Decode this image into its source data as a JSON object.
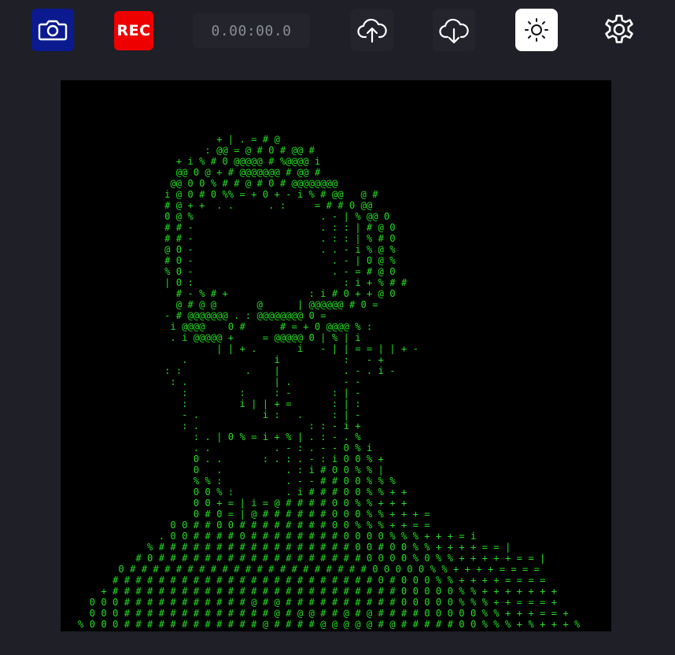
{
  "toolbar": {
    "camera_icon": "camera-icon",
    "rec_label": "REC",
    "timer": "0.00:00.0",
    "upload_icon": "cloud-upload-icon",
    "download_icon": "cloud-download-icon",
    "brightness_icon": "sun-icon",
    "settings_icon": "gear-icon",
    "colors": {
      "camera_bg": "#0b1a8f",
      "rec_bg": "#ee0000",
      "brightness_bg": "#ffffff",
      "page_bg": "#1e1f27",
      "ascii_fg": "#22dd22"
    }
  },
  "viewport": {
    "ascii_art": "                                                    \n                           + | . = # @              \n                         : @@ = @ # 0 # @@ #        \n                    + i % # 0 @@@@@ # %@@@@ i       \n                    @@ 0 @ + # @@@@@@@ # @@ #       \n                   @@ 0 0 % # # @ # 0 # @@@@@@@@     \n                  i @ 0 # 0 %% = + 0 + - i % # @@   @ #\n                  # @ + +  . .      . :     = # # 0 @@\n                  0 @ %                      . - | % @@ 0\n                  # # -                      . : : | # @ 0\n                  # # -                      . : : | % # 0\n                  @ 0 -                      . . - i % @ %\n                  # 0 -                        . - | 0 @ %\n                  % 0 -                        . - = # @ 0\n                  | 0 :                          : i + % # #\n                    # - % # +              : i # 0 + + @ 0\n                    @ # @ @       @      | @@@@@@ # 0 =\n                  - # @@@@@@@ . : @@@@@@@@ 0 =\n                   i @@@@    0 #      # = + 0 @@@@ % :\n                   . i @@@@@ +     = @@@@@ 0 | % | i\n                           | | + .       i   - | | = = | | + -\n                     .               i           :   - +\n                  : :           .    |           . - . i -\n                   : .               | .         - -\n                     :         :     : -       : | -\n                     :         i | | + =       : | :\n                     - .           i :   .     : | -\n                     : .                   : : - i +\n                       : . | 0 % = i + % | . : - . %\n                       . .           . - : . - - 0 % i\n                       0 . .       : . : . - : i 0 0 % +\n                       0   .           . : i # 0 0 % % |\n                       % % :           . - - # # 0 0 % % %\n                       0 0 % :         . i # # # 0 0 % % + +\n                       0 0 + = | i = @ # # # # 0 0 % % + + +\n                       0 # 0 = | @ # # # # # # 0 0 0 % % + + + =\n                   0 0 # # 0 0 # # # # # # # # 0 0 % % % + + = =\n                 . 0 0 # # # # 0 # # # # # # # # 0 0 0 0 % % % + + + = i\n               % # # # # # # # # # # # # # # # # # 0 0 # 0 0 % % + + + + = = |\n             # 0 # # # # # # # # # # # # # # # # # # 0 0 0 0 % 0 % % + + + + + = = |\n          0 # # # # # # # # # # # # # # # # # # # # # 0 0 0 0 0 % % + + + + = = = =\n         # # # # # # # # # # # # # # # # # # # # # # # 0 # 0 0 0 % % + + + + = = = =\n       + # # # # # # # # # # # # # # # # # # # # # # # # # 0 0 0 0 0 % % + + + + + + +\n     0 0 0 # # # # # # # # # # # @ # @ # # # # # # # # # # 0 0 0 0 0 % % % + + = = = +\n     0 0 0 # # # # # # # # # # # # # @ # @ @ # # @ # @ # # # # 0 0 0 0 0 % % + + + = = +\n   % 0 0 0 # # # # # # # # # # # # @ # # # # @ @ @ @ @ # @ # # # # # 0 0 % % % + % + + + %\n   % 0 # # # # # # # # # # @ # @ # # # @ @ @ @ @ @ @ # @ @ # # # # # 0 0 0 % % % % % %"
  }
}
